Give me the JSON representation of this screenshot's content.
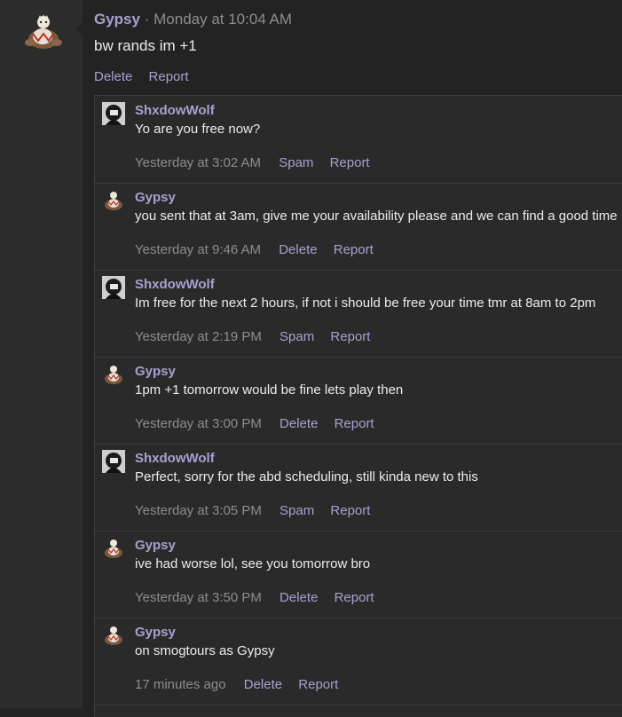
{
  "post": {
    "author": "Gypsy",
    "separator": "·",
    "time": "Monday at 10:04 AM",
    "body": "bw rands im +1",
    "actions": {
      "delete": "Delete",
      "report": "Report"
    }
  },
  "comments": [
    {
      "author": "ShxdowWolf",
      "avatar": "shxdowwolf-avatar",
      "text": "Yo are you free now?",
      "time": "Yesterday at 3:02 AM",
      "action1": "Spam",
      "action2": "Report"
    },
    {
      "author": "Gypsy",
      "avatar": "gypsy-avatar",
      "text": "you sent that at 3am, give me your availability please and we can find a good time",
      "time": "Yesterday at 9:46 AM",
      "action1": "Delete",
      "action2": "Report"
    },
    {
      "author": "ShxdowWolf",
      "avatar": "shxdowwolf-avatar",
      "text": "Im free for the next 2 hours, if not i should be free your time tmr at 8am to 2pm",
      "time": "Yesterday at 2:19 PM",
      "action1": "Spam",
      "action2": "Report"
    },
    {
      "author": "Gypsy",
      "avatar": "gypsy-avatar",
      "text": "1pm +1 tomorrow would be fine lets play then",
      "time": "Yesterday at 3:00 PM",
      "action1": "Delete",
      "action2": "Report"
    },
    {
      "author": "ShxdowWolf",
      "avatar": "shxdowwolf-avatar",
      "text": "Perfect, sorry for the abd scheduling, still kinda new to this",
      "time": "Yesterday at 3:05 PM",
      "action1": "Spam",
      "action2": "Report"
    },
    {
      "author": "Gypsy",
      "avatar": "gypsy-avatar",
      "text": "ive had worse lol, see you tomorrow bro",
      "time": "Yesterday at 3:50 PM",
      "action1": "Delete",
      "action2": "Report"
    },
    {
      "author": "Gypsy",
      "avatar": "gypsy-avatar",
      "text": "on smogtours as Gypsy",
      "time": "17 minutes ago",
      "action1": "Delete",
      "action2": "Report"
    }
  ]
}
